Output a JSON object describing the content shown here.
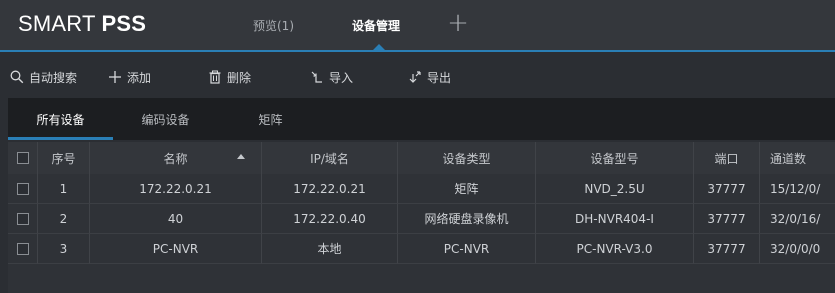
{
  "app": {
    "logo_light": "SMART ",
    "logo_bold": "PSS",
    "tabs": [
      {
        "label": "预览(1)"
      },
      {
        "label": "设备管理"
      }
    ]
  },
  "toolbar": {
    "search": "自动搜索",
    "add": "添加",
    "delete": "删除",
    "import": "导入",
    "export": "导出"
  },
  "subtabs": {
    "all": "所有设备",
    "encoder": "编码设备",
    "matrix": "矩阵"
  },
  "table": {
    "headers": {
      "seq": "序号",
      "name": "名称",
      "ip": "IP/域名",
      "type": "设备类型",
      "model": "设备型号",
      "port": "端口",
      "channels": "通道数"
    },
    "rows": [
      {
        "seq": "1",
        "name": "172.22.0.21",
        "ip": "172.22.0.21",
        "type": "矩阵",
        "model": "NVD_2.5U",
        "port": "37777",
        "channels": "15/12/0/"
      },
      {
        "seq": "2",
        "name": "40",
        "ip": "172.22.0.40",
        "type": "网络硬盘录像机",
        "model": "DH-NVR404-I",
        "port": "37777",
        "channels": "32/0/16/"
      },
      {
        "seq": "3",
        "name": "PC-NVR",
        "ip": "本地",
        "type": "PC-NVR",
        "model": "PC-NVR-V3.0",
        "port": "37777",
        "channels": "32/0/0/0"
      }
    ]
  },
  "colors": {
    "accent": "#2a7fb6",
    "background": "#2b2e33",
    "titlebar": "#34373c"
  }
}
